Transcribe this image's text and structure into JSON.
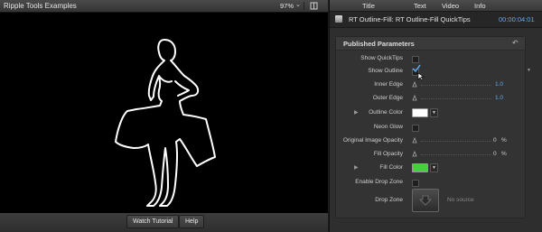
{
  "viewer": {
    "title": "Ripple Tools Examples",
    "zoom": "97%",
    "footer": {
      "watch_tutorial": "Watch Tutorial",
      "help": "Help"
    }
  },
  "inspector": {
    "tabs": [
      "Title",
      "Text",
      "Video",
      "Info"
    ],
    "effect_title": "RT Outline-Fill: RT Outline-Fill QuickTips",
    "timecode": "00:00:04:01",
    "section_title": "Published Parameters",
    "params": {
      "show_quicktips": {
        "label": "Show QuickTips",
        "checked": false
      },
      "show_outline": {
        "label": "Show Outline",
        "checked": true
      },
      "inner_edge": {
        "label": "Inner Edge",
        "value": "1.0"
      },
      "outer_edge": {
        "label": "Outer Edge",
        "value": "1.0"
      },
      "outline_color": {
        "label": "Outline Color",
        "color": "#ffffff"
      },
      "neon_glow": {
        "label": "Neon Glow",
        "checked": false
      },
      "original_image_opacity": {
        "label": "Original Image Opacity",
        "value": "0",
        "unit": "%"
      },
      "fill_opacity": {
        "label": "Fill Opacity",
        "value": "0",
        "unit": "%"
      },
      "fill_color": {
        "label": "Fill Color",
        "color": "#44d13a"
      },
      "enable_drop_zone": {
        "label": "Enable Drop Zone",
        "checked": false
      },
      "drop_zone": {
        "label": "Drop Zone",
        "status": "No source"
      }
    }
  },
  "colors": {
    "accent_blue": "#5ea9ef",
    "timecode_blue": "#6aa7e8",
    "fill_green": "#44d13a",
    "outline_white": "#ffffff"
  }
}
